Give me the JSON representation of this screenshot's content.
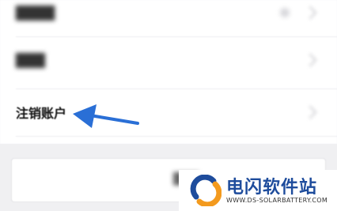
{
  "settings": {
    "items": [
      {
        "label": "",
        "blurred": true
      },
      {
        "label": "",
        "blurred": true
      },
      {
        "label": "注销账户",
        "blurred": false
      }
    ]
  },
  "logout_button": {
    "label": ""
  },
  "annotation": {
    "arrow_color": "#2a6fd6"
  },
  "watermark": {
    "title": "电闪软件站",
    "url": "WWW.DS-SOLARBATTERY.COM",
    "logo_colors": [
      "#1e4c9c",
      "#f39a1e"
    ]
  }
}
